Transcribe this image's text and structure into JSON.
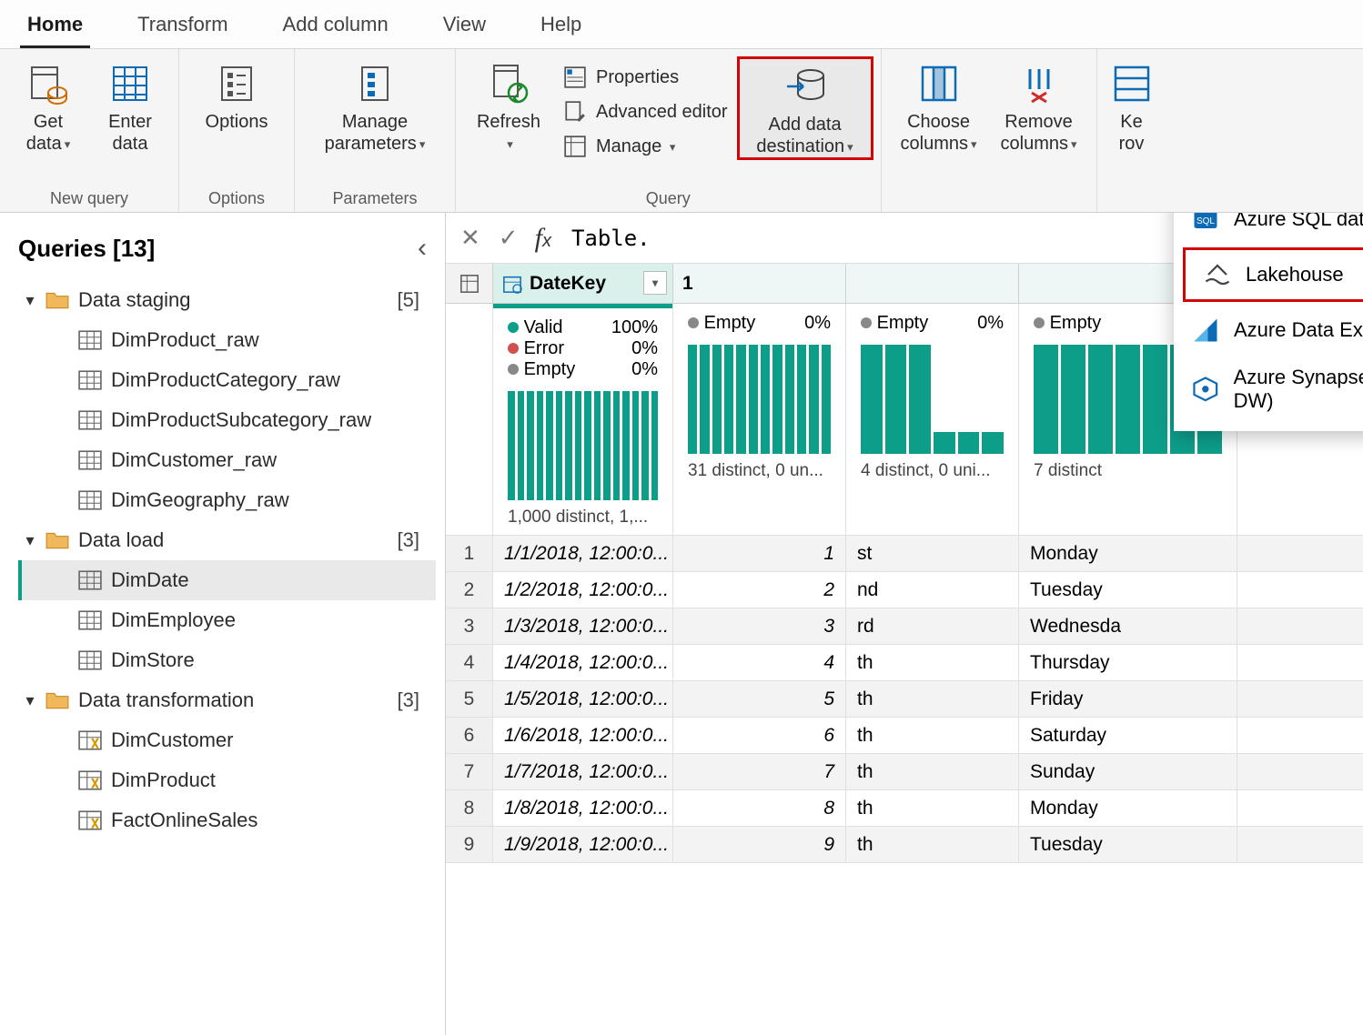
{
  "tabs": {
    "home": "Home",
    "transform": "Transform",
    "addcol": "Add column",
    "view": "View",
    "help": "Help"
  },
  "ribbon": {
    "new_query": {
      "get_data": "Get data",
      "enter_data": "Enter data",
      "label": "New query"
    },
    "options": {
      "options": "Options",
      "label": "Options"
    },
    "parameters": {
      "manage": "Manage parameters",
      "label": "Parameters"
    },
    "query": {
      "refresh": "Refresh",
      "properties": "Properties",
      "advanced": "Advanced editor",
      "manage": "Manage",
      "add_dest": "Add data destination",
      "label": "Query"
    },
    "columns": {
      "choose": "Choose columns",
      "remove": "Remove columns"
    },
    "rows": {
      "keep": "Ke",
      "keep2": "rov"
    }
  },
  "dest_menu": {
    "azure_sql": "Azure SQL database",
    "lakehouse": "Lakehouse",
    "kusto": "Azure Data Explorer (Kusto)",
    "synapse": "Azure Synapse Analytics (SQL DW)"
  },
  "queries": {
    "title": "Queries [13]",
    "groups": [
      {
        "name": "Data staging",
        "count": "[5]",
        "items": [
          "DimProduct_raw",
          "DimProductCategory_raw",
          "DimProductSubcategory_raw",
          "DimCustomer_raw",
          "DimGeography_raw"
        ]
      },
      {
        "name": "Data load",
        "count": "[3]",
        "items": [
          "DimDate",
          "DimEmployee",
          "DimStore"
        ],
        "selected": "DimDate"
      },
      {
        "name": "Data transformation",
        "count": "[3]",
        "items": [
          "DimCustomer",
          "DimProduct",
          "FactOnlineSales"
        ],
        "fx": true
      }
    ]
  },
  "formula": "Table.",
  "columns": [
    {
      "name": "DateKey"
    }
  ],
  "quality": {
    "valid_lbl": "Valid",
    "error_lbl": "Error",
    "empty_lbl": "Empty",
    "valid_pct": "100%",
    "error_pct": "0%",
    "empty_pct": "0%",
    "col2_empty_lbl": "Empty",
    "col2_empty_pct": "0%",
    "col3_empty_lbl": "Empty",
    "col3_empty_pct": "0%",
    "col4_empty_lbl": "Empty",
    "distinct1": "1,000 distinct, 1,...",
    "distinct2": "31 distinct, 0 un...",
    "distinct3": "4 distinct, 0 uni...",
    "distinct4": "7 distinct"
  },
  "rows": [
    {
      "n": "1",
      "date": "1/1/2018, 12:00:0...",
      "num": "1",
      "suf": "st",
      "day": "Monday"
    },
    {
      "n": "2",
      "date": "1/2/2018, 12:00:0...",
      "num": "2",
      "suf": "nd",
      "day": "Tuesday"
    },
    {
      "n": "3",
      "date": "1/3/2018, 12:00:0...",
      "num": "3",
      "suf": "rd",
      "day": "Wednesda"
    },
    {
      "n": "4",
      "date": "1/4/2018, 12:00:0...",
      "num": "4",
      "suf": "th",
      "day": "Thursday"
    },
    {
      "n": "5",
      "date": "1/5/2018, 12:00:0...",
      "num": "5",
      "suf": "th",
      "day": "Friday"
    },
    {
      "n": "6",
      "date": "1/6/2018, 12:00:0...",
      "num": "6",
      "suf": "th",
      "day": "Saturday"
    },
    {
      "n": "7",
      "date": "1/7/2018, 12:00:0...",
      "num": "7",
      "suf": "th",
      "day": "Sunday"
    },
    {
      "n": "8",
      "date": "1/8/2018, 12:00:0...",
      "num": "8",
      "suf": "th",
      "day": "Monday"
    },
    {
      "n": "9",
      "date": "1/9/2018, 12:00:0...",
      "num": "9",
      "suf": "th",
      "day": "Tuesday"
    }
  ]
}
